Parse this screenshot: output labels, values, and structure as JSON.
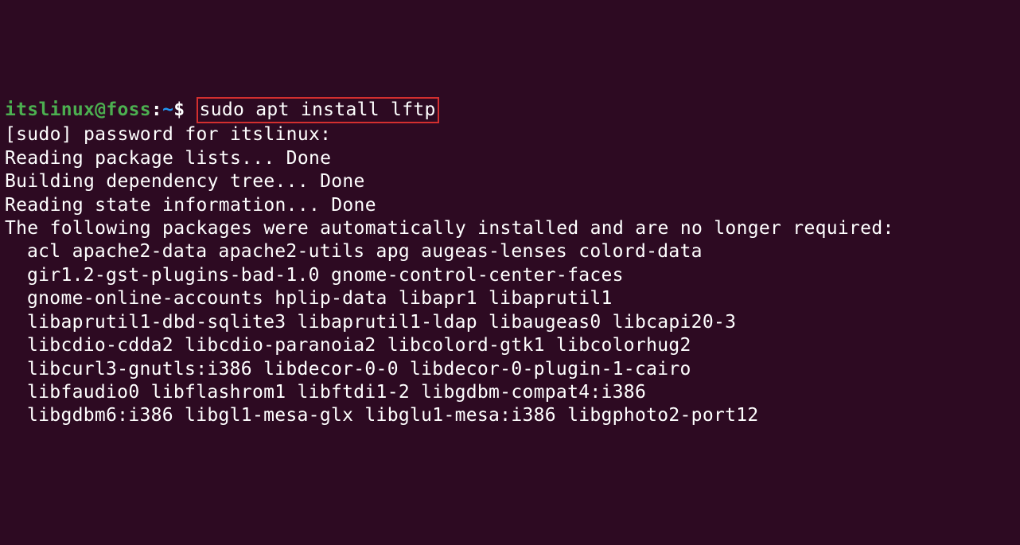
{
  "prompt": {
    "user_host": "itslinux@foss",
    "separator": ":",
    "path": "~",
    "symbol": "$"
  },
  "command": "sudo apt install lftp",
  "output": {
    "line1": "[sudo] password for itslinux:",
    "line2": "Reading package lists... Done",
    "line3": "Building dependency tree... Done",
    "line4": "Reading state information... Done",
    "line5": "The following packages were automatically installed and are no longer required:",
    "packages": [
      "acl apache2-data apache2-utils apg augeas-lenses colord-data",
      "gir1.2-gst-plugins-bad-1.0 gnome-control-center-faces",
      "gnome-online-accounts hplip-data libapr1 libaprutil1",
      "libaprutil1-dbd-sqlite3 libaprutil1-ldap libaugeas0 libcapi20-3",
      "libcdio-cdda2 libcdio-paranoia2 libcolord-gtk1 libcolorhug2",
      "libcurl3-gnutls:i386 libdecor-0-0 libdecor-0-plugin-1-cairo",
      "libfaudio0 libflashrom1 libftdi1-2 libgdbm-compat4:i386",
      "libgdbm6:i386 libgl1-mesa-glx libglu1-mesa:i386 libgphoto2-port12"
    ]
  }
}
